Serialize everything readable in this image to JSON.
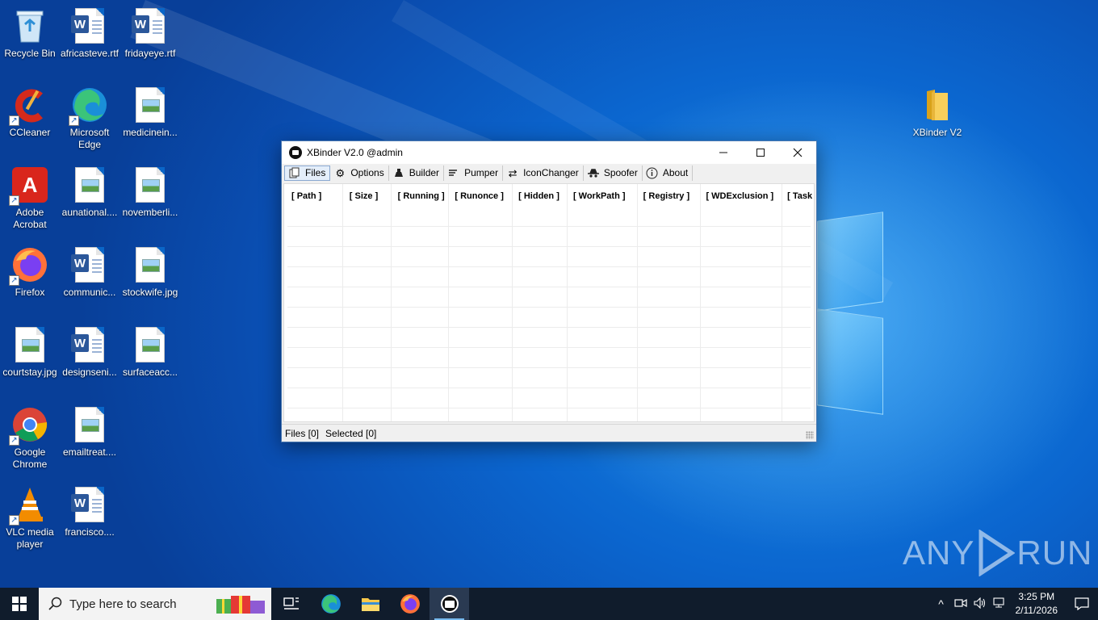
{
  "desktop": {
    "icons": [
      {
        "label": "Recycle Bin",
        "icon": "recycle-bin-icon"
      },
      {
        "label": "africasteve.rtf",
        "icon": "word-doc-icon"
      },
      {
        "label": "fridayeye.rtf",
        "icon": "word-doc-icon"
      },
      {
        "label": "CCleaner",
        "icon": "ccleaner-icon"
      },
      {
        "label": "Microsoft Edge",
        "icon": "edge-icon"
      },
      {
        "label": "medicinein...",
        "icon": "image-file-icon"
      },
      {
        "label": "Adobe Acrobat",
        "icon": "acrobat-icon"
      },
      {
        "label": "aunational....",
        "icon": "image-file-icon"
      },
      {
        "label": "novemberli...",
        "icon": "image-file-icon"
      },
      {
        "label": "Firefox",
        "icon": "firefox-icon"
      },
      {
        "label": "communic...",
        "icon": "word-doc-icon"
      },
      {
        "label": "stockwife.jpg",
        "icon": "image-file-icon"
      },
      {
        "label": "courtstay.jpg",
        "icon": "image-file-icon"
      },
      {
        "label": "designseni...",
        "icon": "word-doc-icon"
      },
      {
        "label": "surfaceacc...",
        "icon": "image-file-icon"
      },
      {
        "label": "Google Chrome",
        "icon": "chrome-icon"
      },
      {
        "label": "emailtreat....",
        "icon": "image-file-icon"
      },
      {
        "label": "VLC media player",
        "icon": "vlc-icon"
      },
      {
        "label": "francisco....",
        "icon": "word-doc-icon"
      },
      {
        "label": "XBinder V2",
        "icon": "folder-icon"
      }
    ]
  },
  "window": {
    "title": "XBinder V2.0 @admin",
    "controls": {
      "minimize": "—",
      "maximize": "☐",
      "close": "✕"
    },
    "tabs": [
      {
        "label": "Files",
        "icon": "files-icon"
      },
      {
        "label": "Options",
        "icon": "gear-icon"
      },
      {
        "label": "Builder",
        "icon": "builder-icon"
      },
      {
        "label": "Pumper",
        "icon": "pumper-icon"
      },
      {
        "label": "IconChanger",
        "icon": "swap-icon"
      },
      {
        "label": "Spoofer",
        "icon": "spoofer-icon"
      },
      {
        "label": "About",
        "icon": "info-icon"
      }
    ],
    "active_tab": "Files",
    "columns": [
      "[ Path ]",
      "[ Size ]",
      "[ Running ]",
      "[ Runonce ]",
      "[ Hidden ]",
      "[ WorkPath ]",
      "[ Registry ]",
      "[ WDExclusion ]",
      "[ Task"
    ],
    "rows": [],
    "status": {
      "files": "Files [0]",
      "selected": "Selected [0]"
    }
  },
  "watermark": {
    "left": "ANY",
    "right": "RUN"
  },
  "taskbar": {
    "search_placeholder": "Type here to search",
    "items": [
      "task-view-icon",
      "edge-icon",
      "file-explorer-icon",
      "firefox-icon",
      "xbinder-icon"
    ],
    "clock": {
      "time": "3:25 PM",
      "date": "2/11/2026"
    }
  },
  "colors": {
    "accent": "#0a66c8",
    "taskbar": "#101c2c",
    "word": "#2b579a"
  }
}
